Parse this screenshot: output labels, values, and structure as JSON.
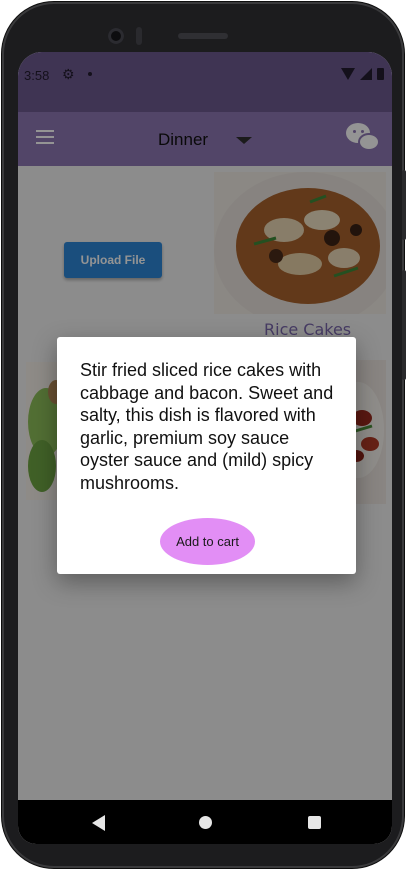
{
  "status_bar": {
    "time": "3:58"
  },
  "app_bar": {
    "category": "Dinner"
  },
  "content": {
    "upload_label": "Upload File",
    "dish_caption": "Rice Cakes"
  },
  "dialog": {
    "description": "Stir fried sliced rice cakes with cabbage and bacon. Sweet and salty, this dish is flavored with garlic, premium soy sauce oyster sauce and (mild) spicy mushrooms.",
    "add_to_cart_label": "Add to cart"
  },
  "icons": {
    "menu": "hamburger-menu-icon",
    "dropdown": "chevron-down-icon",
    "chat": "wechat-icon",
    "settings": "gear-icon",
    "wifi": "wifi-icon",
    "signal": "signal-icon",
    "battery": "battery-icon"
  },
  "colors": {
    "status_bar": "#6d5a8f",
    "app_bar": "#8e77b3",
    "upload_button": "#2d87d8",
    "cart_button": "#e28ef5",
    "caption": "#7b68ad"
  }
}
